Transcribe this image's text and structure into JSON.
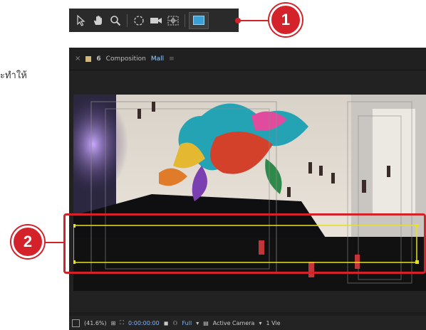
{
  "side_text": "ะทำให้",
  "toolbar": {
    "tools": [
      {
        "name": "selection-tool",
        "glyph": "↖"
      },
      {
        "name": "hand-tool",
        "glyph": "✋"
      },
      {
        "name": "zoom-tool",
        "glyph": "⌕"
      },
      {
        "name": "rotation-tool",
        "glyph": "↻"
      },
      {
        "name": "camera-tool",
        "glyph": "■"
      },
      {
        "name": "pan-behind-tool",
        "glyph": "▣"
      }
    ],
    "active_tool": "rectangle-tool"
  },
  "callouts": [
    {
      "number": "1"
    },
    {
      "number": "2"
    }
  ],
  "panel": {
    "close": "×",
    "lock": "6",
    "tab_label": "Composition",
    "comp_name": "Mall",
    "menu": "≡"
  },
  "status_bar": {
    "zoom": "(41.6%)",
    "timecode": "0:00:00:00",
    "resolution": "Full",
    "camera": "Active Camera",
    "view": "1 Vie"
  },
  "colors": {
    "accent_red": "#d3222a",
    "mask_yellow": "#e8e21a",
    "shape_blue": "#3aa0d8"
  }
}
